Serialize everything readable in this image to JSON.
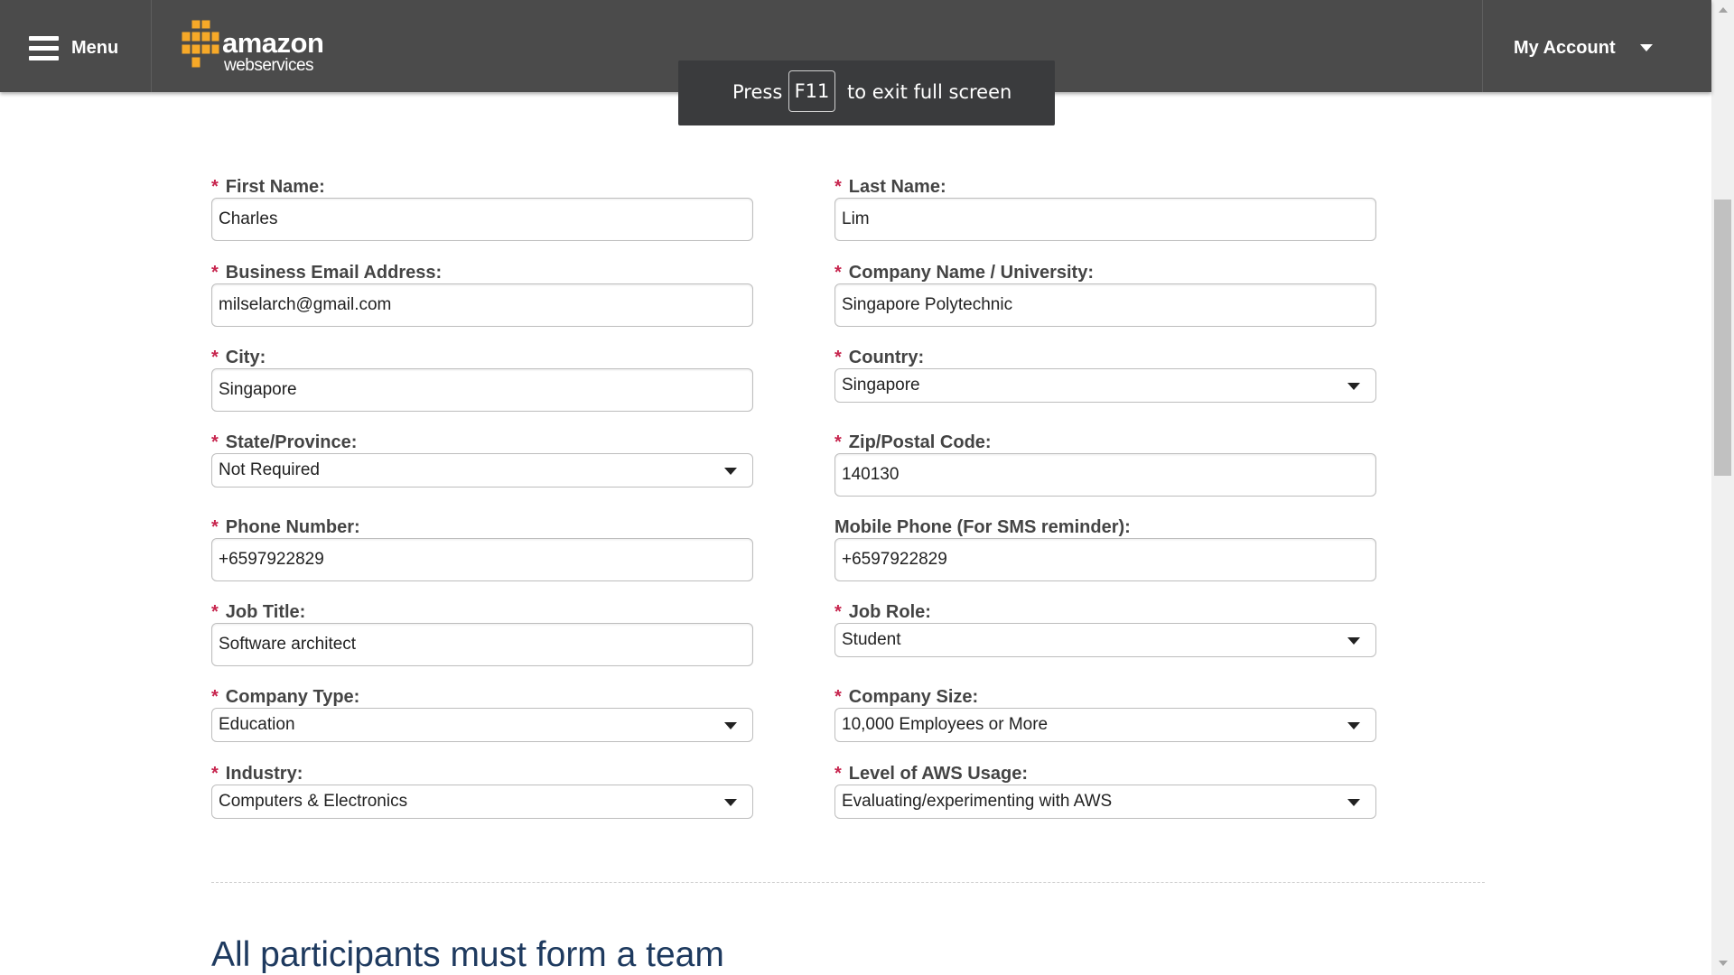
{
  "nav": {
    "menu_label": "Menu",
    "logo_line1": "amazon",
    "logo_line2": "webservices",
    "account_label": "My Account"
  },
  "toast": {
    "press": "Press",
    "key": "F11",
    "rest": "to exit full screen"
  },
  "form": {
    "first_name": {
      "label": "First Name:",
      "required": "*",
      "value": "Charles"
    },
    "last_name": {
      "label": "Last Name:",
      "required": "*",
      "value": "Lim"
    },
    "email": {
      "label": "Business Email Address:",
      "required": "*",
      "value": "milselarch@gmail.com"
    },
    "company": {
      "label": "Company Name / University:",
      "required": "*",
      "value": "Singapore Polytechnic"
    },
    "city": {
      "label": "City:",
      "required": "*",
      "value": "Singapore"
    },
    "country": {
      "label": "Country:",
      "required": "*",
      "value": "Singapore"
    },
    "state": {
      "label": "State/Province:",
      "required": "*",
      "value": "Not Required"
    },
    "zip": {
      "label": "Zip/Postal Code:",
      "required": "*",
      "value": "140130"
    },
    "phone": {
      "label": "Phone Number:",
      "required": "*",
      "value": "+6597922829"
    },
    "mobile": {
      "label": "Mobile Phone (For SMS reminder):",
      "value": "+6597922829"
    },
    "job_title": {
      "label": "Job Title:",
      "required": "*",
      "value": "Software architect"
    },
    "job_role": {
      "label": "Job Role:",
      "required": "*",
      "value": "Student"
    },
    "company_type": {
      "label": "Company Type:",
      "required": "*",
      "value": "Education"
    },
    "company_size": {
      "label": "Company Size:",
      "required": "*",
      "value": "10,000 Employees or More"
    },
    "industry": {
      "label": "Industry:",
      "required": "*",
      "value": "Computers & Electronics"
    },
    "aws_usage": {
      "label": "Level of AWS Usage:",
      "required": "*",
      "value": "Evaluating/experimenting with AWS"
    }
  },
  "section": {
    "heading": "All participants must form a team"
  },
  "icons": {
    "menu": "hamburger-icon",
    "account_caret": "caret-down-icon",
    "select_caret": "caret-down-icon",
    "logo": "aws-logo"
  },
  "colors": {
    "nav_bg": "#4b4b4b",
    "logo_orange": "#f7a928",
    "required_star": "#c7254e",
    "heading": "#1e3a5f",
    "toast_bg": "#3a3b3d"
  }
}
